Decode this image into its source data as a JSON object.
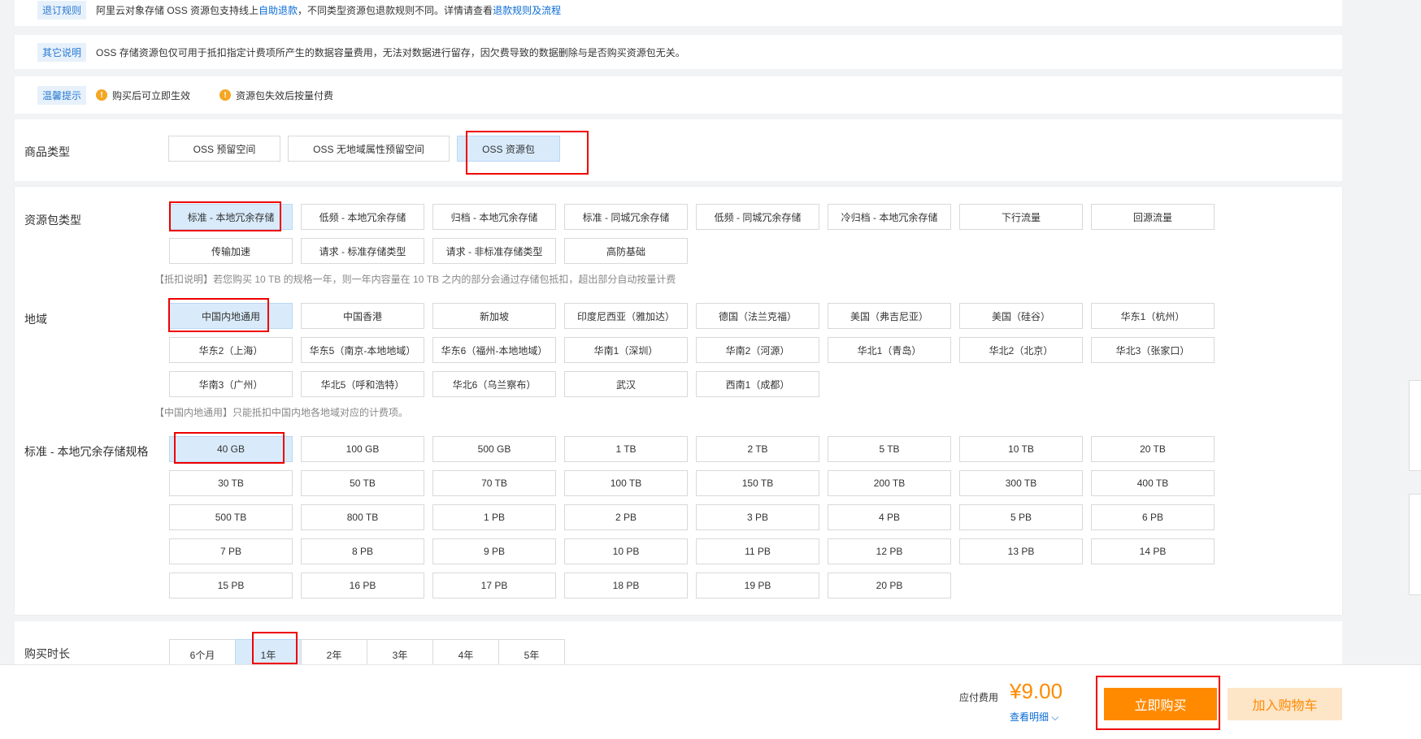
{
  "notices": {
    "refund": {
      "tag": "退订规则",
      "text_a": "阿里云对象存储 OSS 资源包支持线上",
      "link_a": "自助退款",
      "text_b": "，不同类型资源包退款规则不同。详情请查看",
      "link_b": "退款规则及流程"
    },
    "other": {
      "tag": "其它说明",
      "text": "OSS 存储资源包仅可用于抵扣指定计费项所产生的数据容量费用，无法对数据进行留存，因欠费导致的数据删除与是否购买资源包无关。"
    },
    "tips": {
      "tag": "温馨提示",
      "items": [
        "购买后可立即生效",
        "资源包失效后按量付费"
      ]
    }
  },
  "product_type": {
    "label": "商品类型",
    "options": [
      "OSS 预留空间",
      "OSS 无地域属性预留空间",
      "OSS 资源包"
    ],
    "selected": "OSS 资源包"
  },
  "package_type": {
    "label": "资源包类型",
    "options": [
      "标准 - 本地冗余存储",
      "低频 - 本地冗余存储",
      "归档 - 本地冗余存储",
      "标准 - 同城冗余存储",
      "低频 - 同城冗余存储",
      "冷归档 - 本地冗余存储",
      "下行流量",
      "回源流量",
      "传输加速",
      "请求 - 标准存储类型",
      "请求 - 非标准存储类型",
      "高防基础"
    ],
    "selected": "标准 - 本地冗余存储",
    "note": "【抵扣说明】若您购买 10 TB 的规格一年，则一年内容量在 10 TB 之内的部分会通过存储包抵扣，超出部分自动按量计费"
  },
  "region": {
    "label": "地域",
    "options": [
      "中国内地通用",
      "中国香港",
      "新加坡",
      "印度尼西亚（雅加达）",
      "德国（法兰克福）",
      "美国（弗吉尼亚）",
      "美国（硅谷）",
      "华东1（杭州）",
      "华东2（上海）",
      "华东5（南京-本地地域）",
      "华东6（福州-本地地域）",
      "华南1（深圳）",
      "华南2（河源）",
      "华北1（青岛）",
      "华北2（北京）",
      "华北3（张家口）",
      "华南3（广州）",
      "华北5（呼和浩特）",
      "华北6（乌兰察布）",
      "武汉",
      "西南1（成都）"
    ],
    "selected": "中国内地通用",
    "note": "【中国内地通用】只能抵扣中国内地各地域对应的计费项。"
  },
  "spec": {
    "label": "标准 - 本地冗余存储规格",
    "options": [
      "40 GB",
      "100 GB",
      "500 GB",
      "1 TB",
      "2 TB",
      "5 TB",
      "10 TB",
      "20 TB",
      "30 TB",
      "50 TB",
      "70 TB",
      "100 TB",
      "150 TB",
      "200 TB",
      "300 TB",
      "400 TB",
      "500 TB",
      "800 TB",
      "1 PB",
      "2 PB",
      "3 PB",
      "4 PB",
      "5 PB",
      "6 PB",
      "7 PB",
      "8 PB",
      "9 PB",
      "10 PB",
      "11 PB",
      "12 PB",
      "13 PB",
      "14 PB",
      "15 PB",
      "16 PB",
      "17 PB",
      "18 PB",
      "19 PB",
      "20 PB"
    ],
    "selected": "40 GB"
  },
  "duration": {
    "label": "购买时长",
    "options": [
      "6个月",
      "1年",
      "2年",
      "3年",
      "4年",
      "5年"
    ],
    "selected": "1年"
  },
  "footer": {
    "fee_label": "应付费用",
    "price": "¥9.00",
    "detail_link": "查看明细",
    "buy_now": "立即购买",
    "add_cart": "加入购物车"
  },
  "colors": {
    "accent_orange": "#ff8a00",
    "link_blue": "#0a6cd6",
    "selected_bg": "#d9ebfb",
    "highlight_red": "#e00000"
  }
}
